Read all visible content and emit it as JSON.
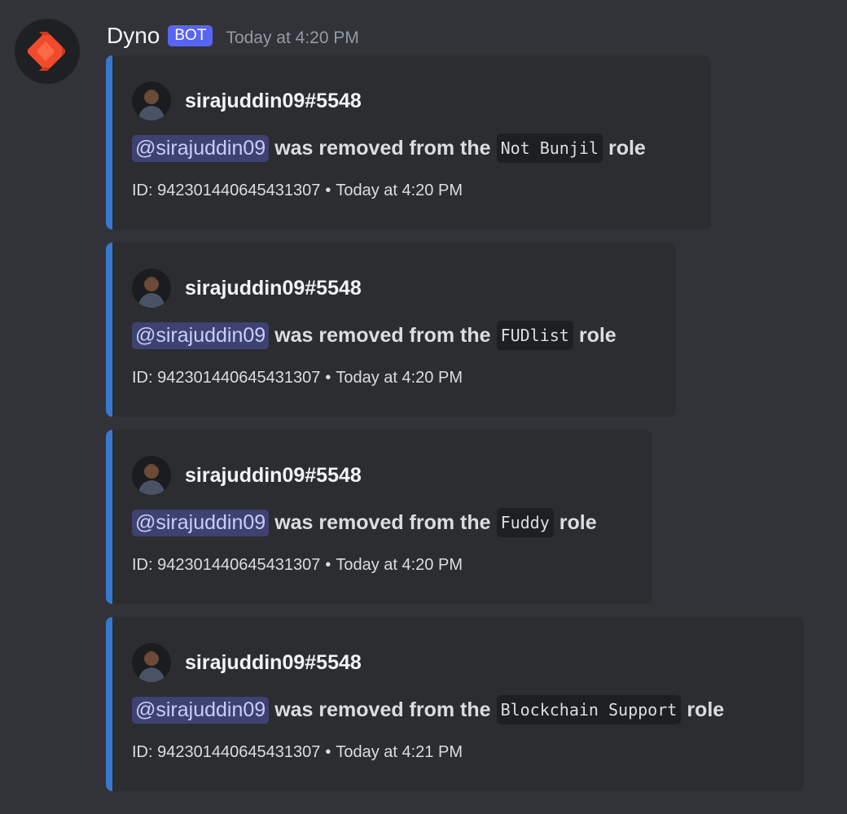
{
  "message": {
    "author": "Dyno",
    "bot_tag": "BOT",
    "timestamp": "Today at 4:20 PM",
    "accent_color": "#3a78cf",
    "avatar_icon": "dyno-logo-icon"
  },
  "embeds": [
    {
      "author": "sirajuddin09#5548",
      "mention": "@sirajuddin09",
      "text": "was removed from the",
      "role": "Not Bunjil",
      "suffix": "role",
      "footer_id": "ID: 942301440645431307",
      "separator": "•",
      "footer_time": "Today at 4:20 PM"
    },
    {
      "author": "sirajuddin09#5548",
      "mention": "@sirajuddin09",
      "text": "was removed from the",
      "role": "FUDlist",
      "suffix": "role",
      "footer_id": "ID: 942301440645431307",
      "separator": "•",
      "footer_time": "Today at 4:20 PM"
    },
    {
      "author": "sirajuddin09#5548",
      "mention": "@sirajuddin09",
      "text": "was removed from the",
      "role": "Fuddy",
      "suffix": "role",
      "footer_id": "ID: 942301440645431307",
      "separator": "•",
      "footer_time": "Today at 4:20 PM"
    },
    {
      "author": "sirajuddin09#5548",
      "mention": "@sirajuddin09",
      "text": "was removed from the",
      "role": "Blockchain Support",
      "suffix": "role",
      "footer_id": "ID: 942301440645431307",
      "separator": "•",
      "footer_time": "Today at 4:21 PM"
    }
  ]
}
